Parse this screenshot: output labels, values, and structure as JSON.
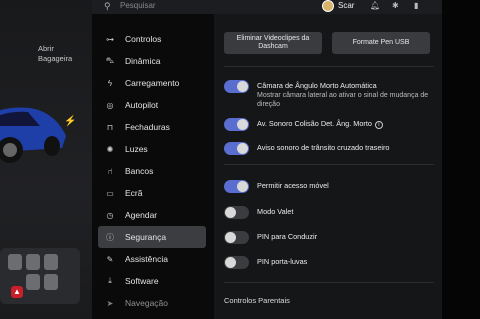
{
  "left": {
    "abrir_line1": "Abrir",
    "abrir_line2": "Bagageira"
  },
  "topbar": {
    "search_placeholder": "Pesquisar",
    "user": "Scar"
  },
  "menu": [
    {
      "label": "Controlos",
      "icon": "toggles-icon"
    },
    {
      "label": "Dinâmica",
      "icon": "car-icon"
    },
    {
      "label": "Carregamento",
      "icon": "bolt-icon"
    },
    {
      "label": "Autopilot",
      "icon": "steering-wheel-icon"
    },
    {
      "label": "Fechaduras",
      "icon": "lock-icon"
    },
    {
      "label": "Luzes",
      "icon": "light-bulb-icon"
    },
    {
      "label": "Bancos",
      "icon": "seat-icon"
    },
    {
      "label": "Ecrã",
      "icon": "display-icon"
    },
    {
      "label": "Agendar",
      "icon": "clock-icon"
    },
    {
      "label": "Segurança",
      "icon": "alert-circle-icon",
      "active": true
    },
    {
      "label": "Assistência",
      "icon": "wrench-icon"
    },
    {
      "label": "Software",
      "icon": "download-icon"
    },
    {
      "label": "Navegação",
      "icon": "navigation-icon"
    }
  ],
  "main": {
    "eliminar_button": "Eliminar Videoclipes da Dashcam",
    "formate_button": "Formate Pen USB",
    "settings": [
      {
        "label": "Câmara de Ângulo Morto Automática",
        "sub": "Mostrar câmara lateral ao ativar o sinal de mudança de direção",
        "on": true
      },
      {
        "label": "Av. Sonoro Colisão Det. Âng. Morto",
        "on": true,
        "info": true
      },
      {
        "label": "Aviso sonoro de trânsito cruzado traseiro",
        "on": true
      },
      {
        "label": "Permitir acesso móvel",
        "on": true
      },
      {
        "label": "Modo Valet",
        "on": false
      },
      {
        "label": "PIN para Conduzir",
        "on": false
      },
      {
        "label": "PIN porta-luvas",
        "on": false
      }
    ],
    "section_title": "Controlos Parentais"
  },
  "colors": {
    "accent": "#5a6ed0",
    "active_menu_bg": "#3c3d40"
  }
}
